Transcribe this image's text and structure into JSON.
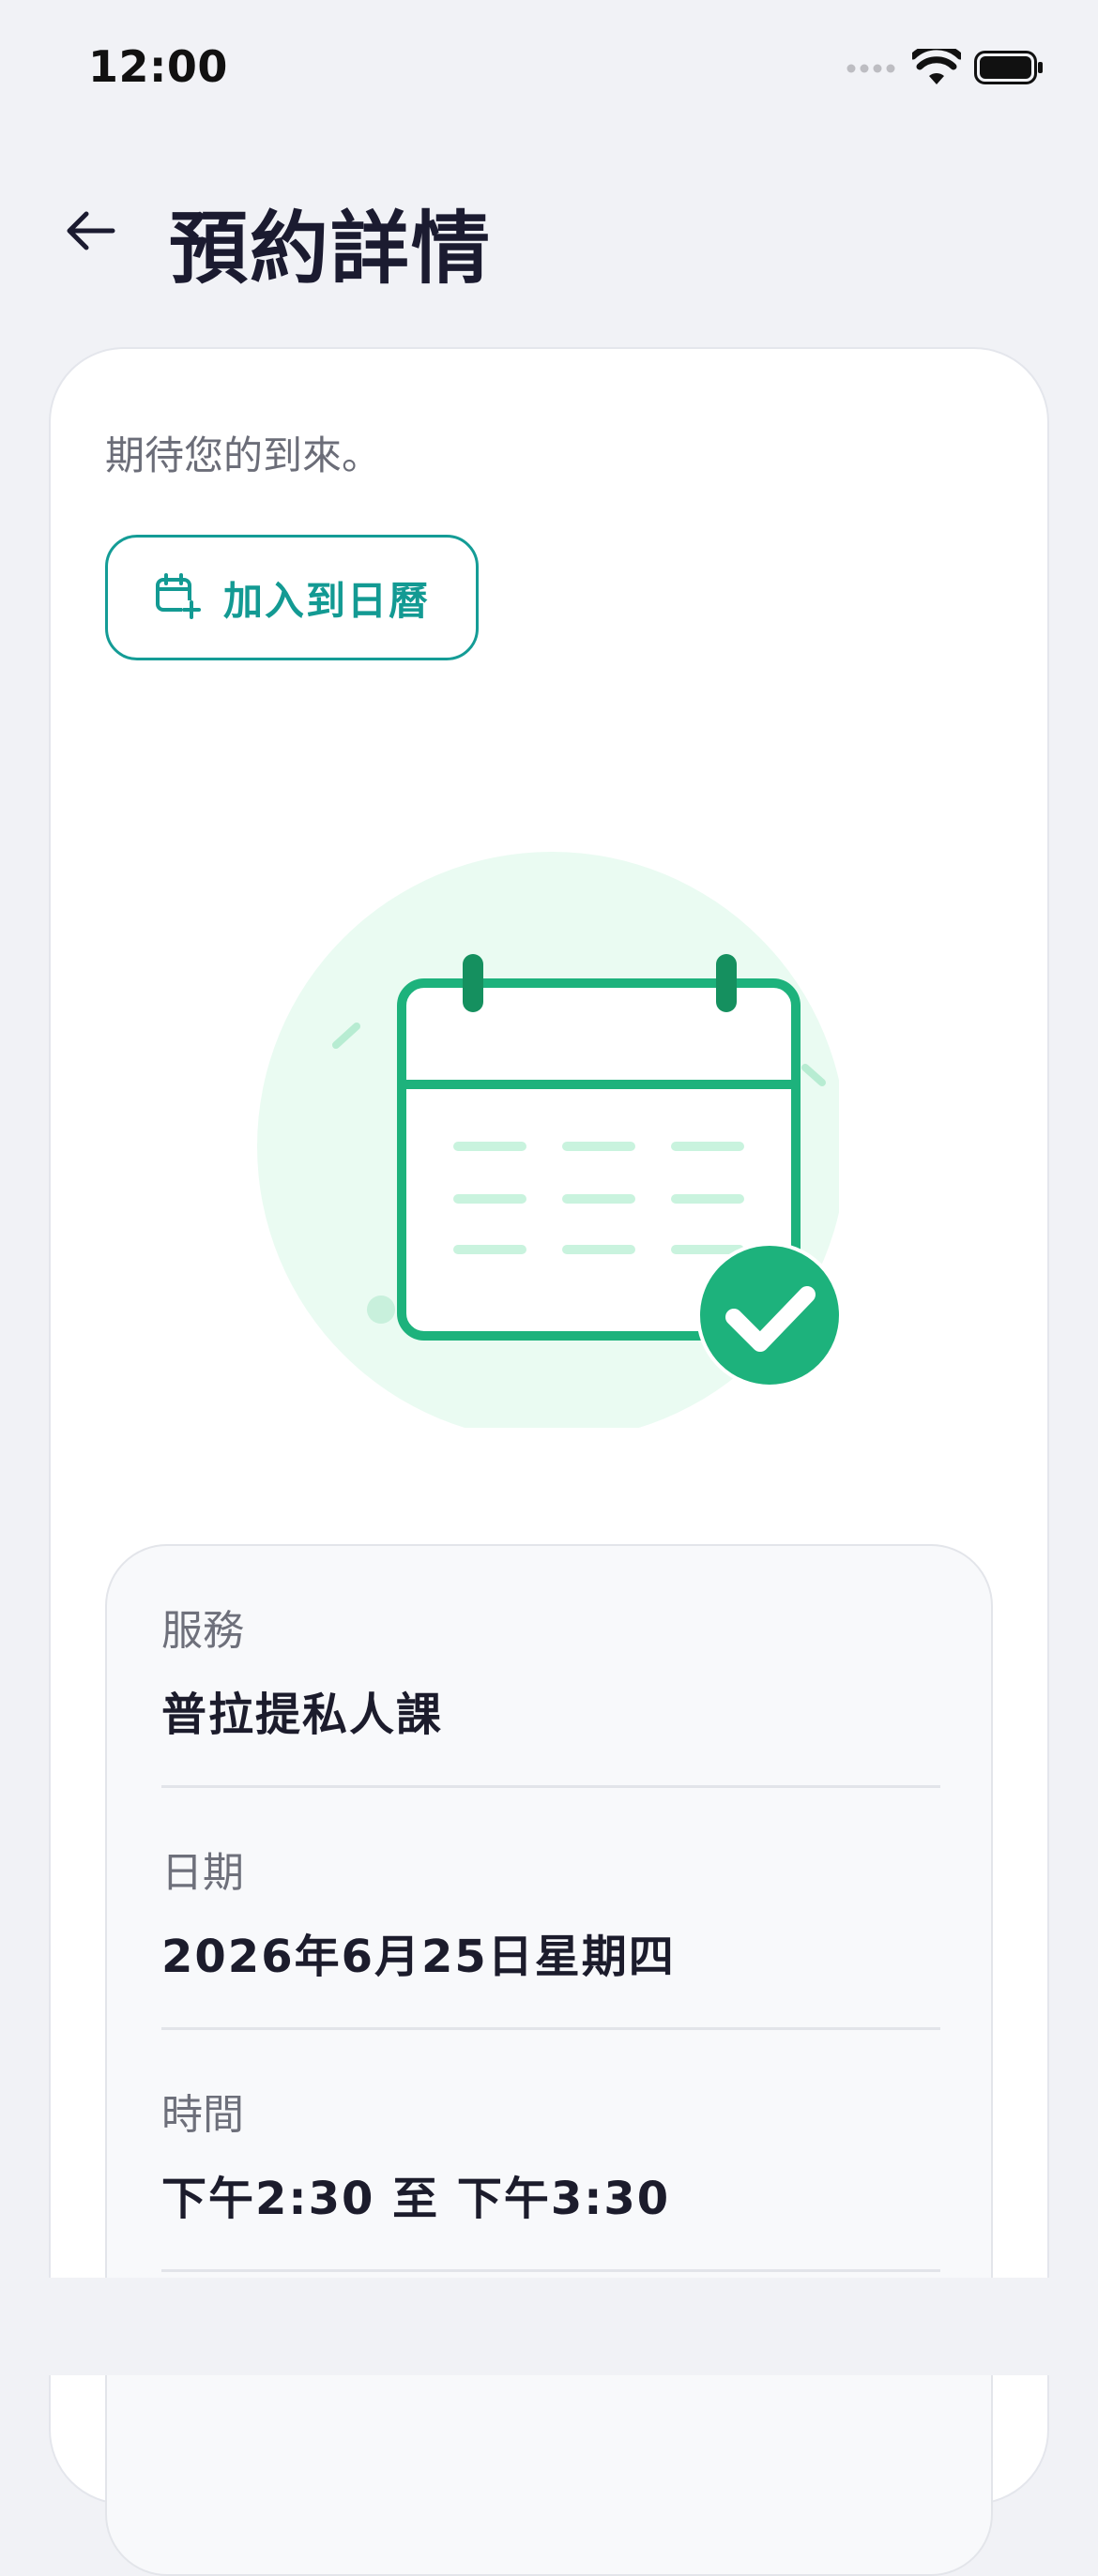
{
  "status_bar": {
    "time": "12:00",
    "icons": [
      "signal-dots-icon",
      "wifi-icon",
      "battery-icon"
    ]
  },
  "header": {
    "title": "預約詳情",
    "back_icon": "arrow-left-icon"
  },
  "card": {
    "subtitle": "期待您的到來。",
    "calendar_button_label": "加入到日曆",
    "calendar_button_icon": "calendar-plus-icon"
  },
  "details": [
    {
      "label": "服務",
      "value": "普拉提私人課"
    },
    {
      "label": "日期",
      "value": "2026年6月25日星期四"
    },
    {
      "label": "時間",
      "value": "下午2:30 至 下午3:30"
    }
  ],
  "colors": {
    "accent_teal": "#149c96",
    "success_green": "#1db27c",
    "illustration_bg": "#eafbf2"
  }
}
